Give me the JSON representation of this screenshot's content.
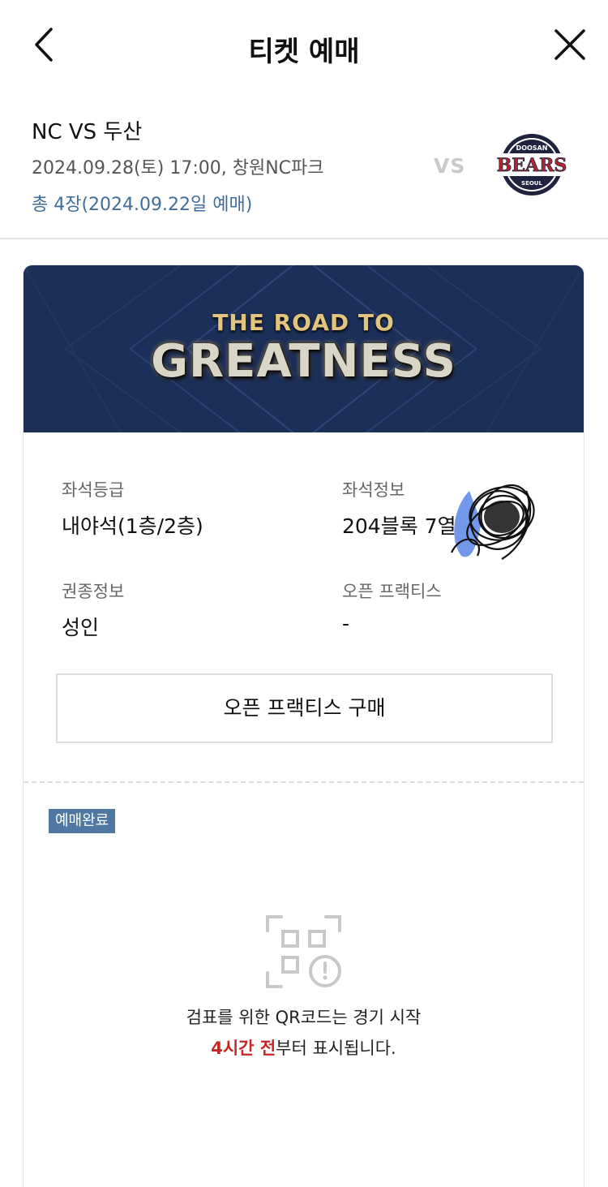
{
  "header": {
    "title": "티켓 예매",
    "back_icon": "chevron-left-icon",
    "close_icon": "close-icon"
  },
  "match": {
    "name": "NC VS 두산",
    "datetime_venue": "2024.09.28(토) 17:00, 창원NC파크",
    "ticket_count": "총 4장(2024.09.22일 예매)",
    "vs": "VS",
    "team_logo": {
      "top_text": "DOOSAN",
      "main_text": "BEARS",
      "bottom_text": "SEOUL"
    }
  },
  "banner": {
    "line1": "THE ROAD TO",
    "line2": "GREATNESS"
  },
  "ticket": {
    "seat_grade_label": "좌석등급",
    "seat_grade_value": "내야석(1층/2층)",
    "seat_info_label": "좌석정보",
    "seat_info_value": "204블록 7열",
    "ticket_type_label": "권종정보",
    "ticket_type_value": "성인",
    "open_practice_label": "오픈 프랙티스",
    "open_practice_value": "-",
    "practice_button": "오픈 프랙티스 구매"
  },
  "status": {
    "badge": "예매완료",
    "qr_line1": "검표를 위한 QR코드는 경기 시작",
    "qr_line2_highlight": "4시간 전",
    "qr_line2_rest": "부터 표시됩니다."
  },
  "colors": {
    "accent": "#3f6e9b",
    "badge": "#4f79a3",
    "banner": "#1a2e57",
    "highlight": "#c62828"
  }
}
